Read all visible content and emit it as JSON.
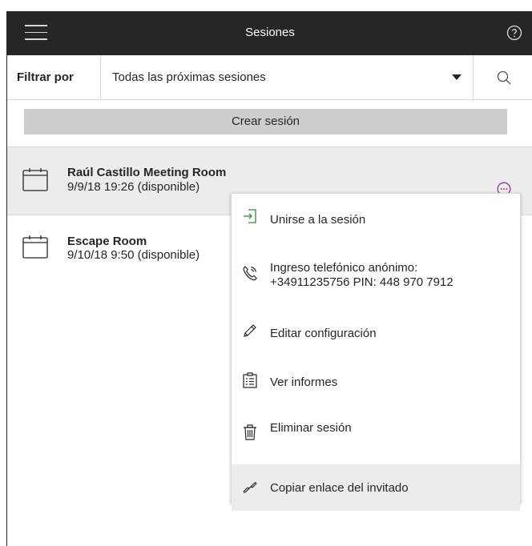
{
  "header": {
    "title": "Sesiones",
    "menu_icon": "hamburger-icon",
    "help_icon": "help-icon"
  },
  "filter": {
    "label": "Filtrar por",
    "selected": "Todas las próximas sesiones",
    "search_icon": "search-icon"
  },
  "actions": {
    "create_label": "Crear sesión"
  },
  "sessions": [
    {
      "name": "Raúl Castillo Meeting Room",
      "datetime": "9/9/18 19:26 (disponible)"
    },
    {
      "name": "Escape Room",
      "datetime": "9/10/18 9:50 (disponible)"
    }
  ],
  "context_menu": {
    "items": [
      {
        "label": "Unirse a la sesión",
        "icon": "join-icon"
      },
      {
        "label_line1": "Ingreso telefónico anónimo:",
        "label_line2": "+34911235756 PIN: 448 970 7912",
        "icon": "phone-icon"
      },
      {
        "label": "Editar configuración",
        "icon": "pencil-icon"
      },
      {
        "label": "Ver informes",
        "icon": "report-icon"
      },
      {
        "label": "Eliminar sesión",
        "icon": "trash-icon"
      },
      {
        "label": "Copiar enlace del invitado",
        "icon": "link-icon"
      }
    ]
  },
  "colors": {
    "topbar": "#262626",
    "accent_more": "#8e3a9c",
    "join_icon": "#2f8f3a"
  }
}
